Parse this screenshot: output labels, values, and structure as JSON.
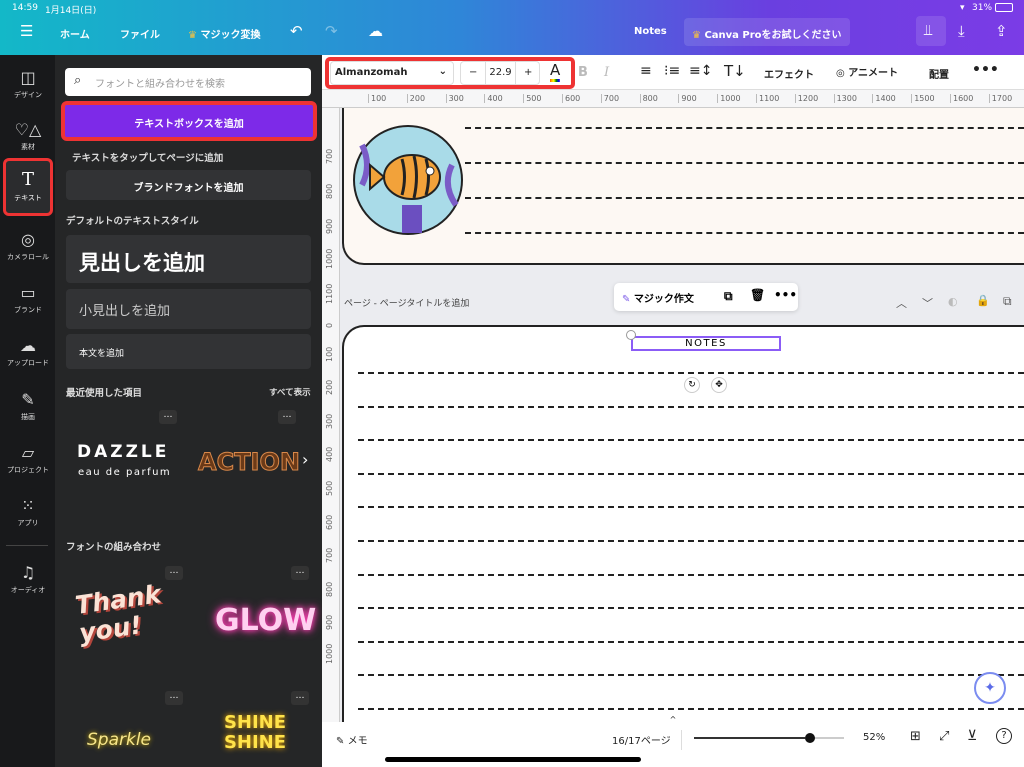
{
  "status": {
    "time": "14:59",
    "date": "1月14日(日)",
    "battery": "31%"
  },
  "nav": {
    "home": "ホーム",
    "file": "ファイル",
    "magic_switch": "マジック変換",
    "title": "Notes",
    "pro": "Canva Proをお試しください"
  },
  "rail": [
    {
      "label": "デザイン",
      "icon": "layout-icon"
    },
    {
      "label": "素材",
      "icon": "elements-icon"
    },
    {
      "label": "テキスト",
      "icon": "text-icon"
    },
    {
      "label": "カメラロール",
      "icon": "camera-icon"
    },
    {
      "label": "ブランド",
      "icon": "brand-icon"
    },
    {
      "label": "アップロード",
      "icon": "upload-icon"
    },
    {
      "label": "描画",
      "icon": "draw-icon"
    },
    {
      "label": "プロジェクト",
      "icon": "folder-icon"
    },
    {
      "label": "アプリ",
      "icon": "apps-icon"
    },
    {
      "label": "オーディオ",
      "icon": "audio-icon"
    }
  ],
  "panel": {
    "search_placeholder": "フォントと組み合わせを検索",
    "add_textbox": "テキストボックスを追加",
    "tap_hint": "テキストをタップしてページに追加",
    "brand_font": "ブランドフォントを追加",
    "default_styles": "デフォルトのテキストスタイル",
    "heading": "見出しを追加",
    "subheading": "小見出しを追加",
    "body": "本文を追加",
    "recent": "最近使用した項目",
    "see_all": "すべて表示",
    "dazzle": "DAZZLE",
    "dazzle_sub": "eau de parfum",
    "action": "ACTION",
    "combos": "フォントの組み合わせ",
    "thank": "Thank you!",
    "glow": "GLOW",
    "sparkle": "Sparkle",
    "shine": "SHINE SHINE"
  },
  "toolbar": {
    "font": "Almanzomah",
    "size": "22.9",
    "minus": "−",
    "plus": "+",
    "effects": "エフェクト",
    "animate": "アニメート",
    "position": "配置"
  },
  "ruler_h": [
    "100",
    "200",
    "300",
    "400",
    "500",
    "600",
    "700",
    "800",
    "900",
    "1000",
    "1100",
    "1200",
    "1300",
    "1400",
    "1500",
    "1600",
    "1700"
  ],
  "ruler_v1": [
    "700",
    "800",
    "900",
    "1000",
    "1100"
  ],
  "ruler_v2": [
    "0",
    "100",
    "200",
    "300",
    "400",
    "500",
    "600",
    "700",
    "800",
    "900",
    "1000"
  ],
  "page": {
    "title": "ページ - ページタイトルを追加",
    "magic_write": "マジック作文",
    "notes_text": "NOTES"
  },
  "bottom": {
    "memo": "メモ",
    "page": "16/17ページ",
    "zoom": "52%",
    "zoom_value": 52
  },
  "colors": {
    "accent": "#7d2ae8",
    "highlight": "#e33333"
  }
}
